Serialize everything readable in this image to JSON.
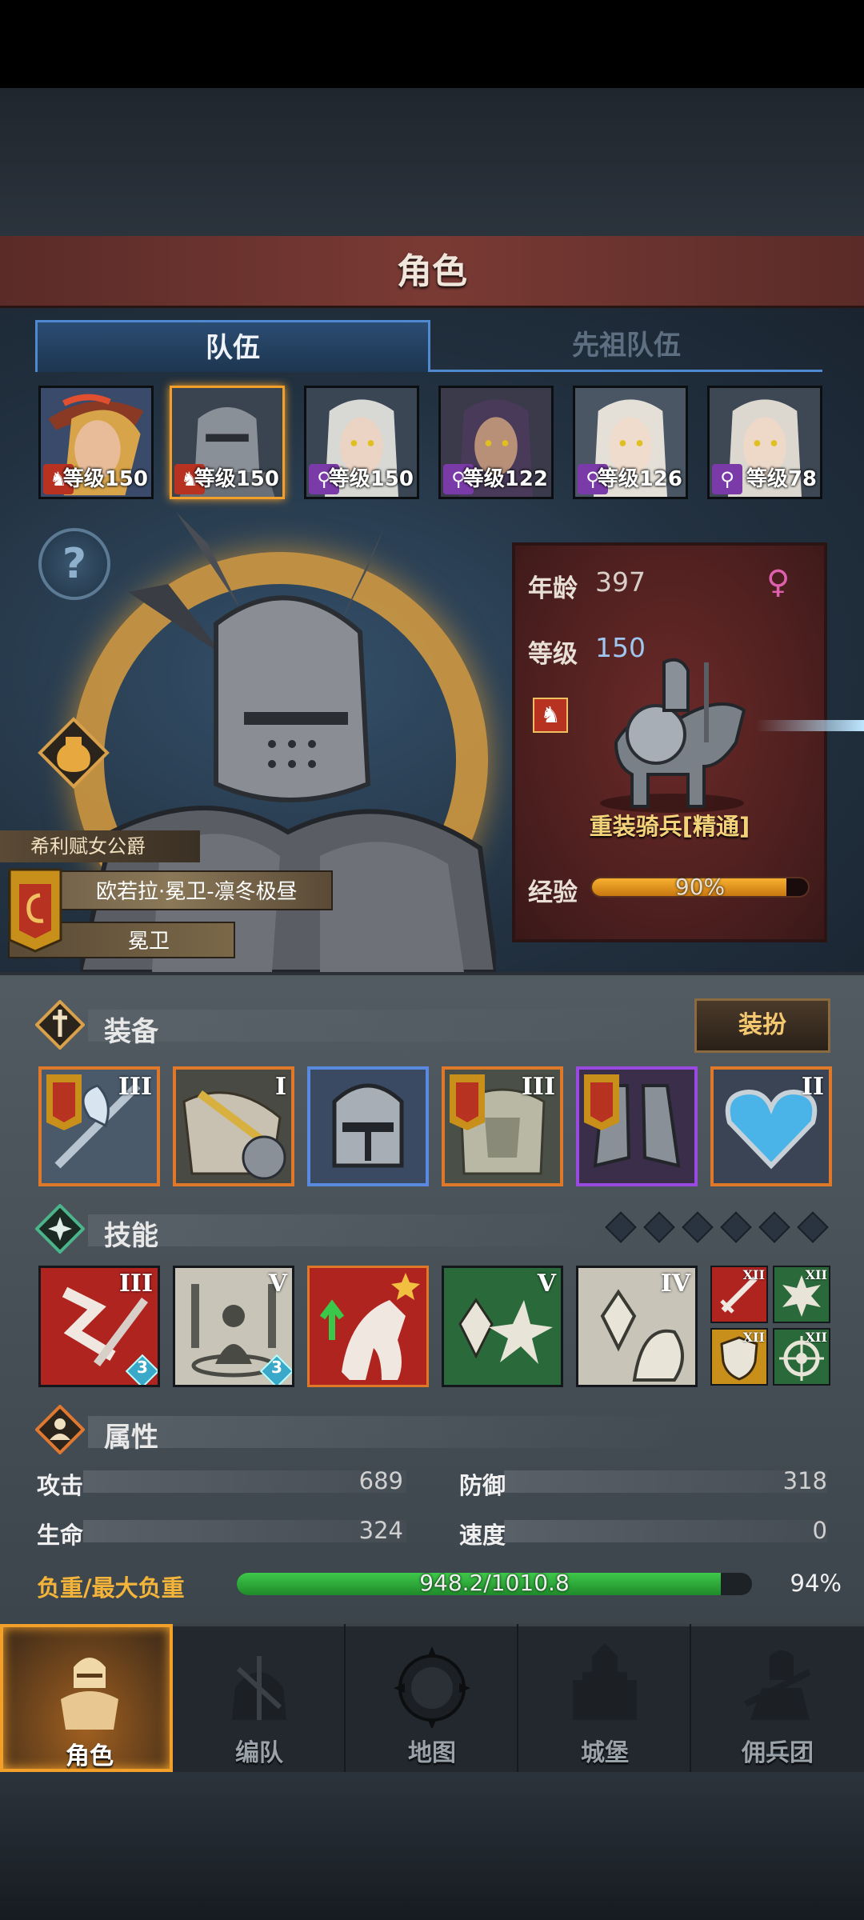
{
  "screen_title": "角色",
  "tabs": {
    "team": "队伍",
    "ancestor_team": "先祖队伍"
  },
  "roster": [
    {
      "level": "等级150",
      "badge": "red"
    },
    {
      "level": "等级150",
      "badge": "red",
      "selected": true
    },
    {
      "level": "等级150",
      "badge": "purple"
    },
    {
      "level": "等级122",
      "badge": "purple"
    },
    {
      "level": "等级126",
      "badge": "purple"
    },
    {
      "level": "等级78",
      "badge": "purple"
    }
  ],
  "hero": {
    "title": "希利赋女公爵",
    "name": "欧若拉·冕卫-凛冬极昼",
    "role": "冕卫"
  },
  "info": {
    "age_label": "年龄",
    "age": "397",
    "level_label": "等级",
    "level": "150",
    "unit_name": "重装骑兵[精通]",
    "exp_label": "经验",
    "exp_text": "90%",
    "exp_fraction": 0.9
  },
  "equipment": {
    "title": "装备",
    "dress_button": "装扮",
    "items": [
      {
        "name": "halberd",
        "tier": "III",
        "border": "orange"
      },
      {
        "name": "gauntlet",
        "tier": "I",
        "border": "orange"
      },
      {
        "name": "helmet",
        "tier": "",
        "border": "blue"
      },
      {
        "name": "armor",
        "tier": "III",
        "border": "orange"
      },
      {
        "name": "boots",
        "tier": "",
        "border": "purple"
      },
      {
        "name": "heart-amulet",
        "tier": "II",
        "border": "orange"
      }
    ]
  },
  "skills": {
    "title": "技能",
    "items": [
      {
        "name": "slash",
        "tier": "III",
        "gem": "3"
      },
      {
        "name": "guard",
        "tier": "V",
        "gem": "3"
      },
      {
        "name": "cavalry",
        "tier": ""
      },
      {
        "name": "crystal-burst",
        "tier": "V"
      },
      {
        "name": "crystal-strike",
        "tier": "IV"
      }
    ],
    "mini": [
      {
        "name": "sword",
        "tier": "XII"
      },
      {
        "name": "burst",
        "tier": "XII"
      },
      {
        "name": "shield",
        "tier": "XII"
      },
      {
        "name": "target",
        "tier": "XII"
      }
    ]
  },
  "attributes": {
    "title": "属性",
    "attack_label": "攻击",
    "attack": "689",
    "defense_label": "防御",
    "defense": "318",
    "hp_label": "生命",
    "hp": "324",
    "speed_label": "速度",
    "speed": "0",
    "load_label": "负重/最大负重",
    "load_text": "948.2/1010.8",
    "load_pct": "94%",
    "load_fraction": 0.94
  },
  "nav": [
    {
      "label": "角色",
      "active": true
    },
    {
      "label": "编队"
    },
    {
      "label": "地图"
    },
    {
      "label": "城堡"
    },
    {
      "label": "佣兵团"
    }
  ],
  "colors": {
    "accent_orange": "#f2a02a",
    "tab_blue": "#4f8ad0",
    "load_green": "#3ec84a",
    "title_red": "#7a3a34"
  }
}
